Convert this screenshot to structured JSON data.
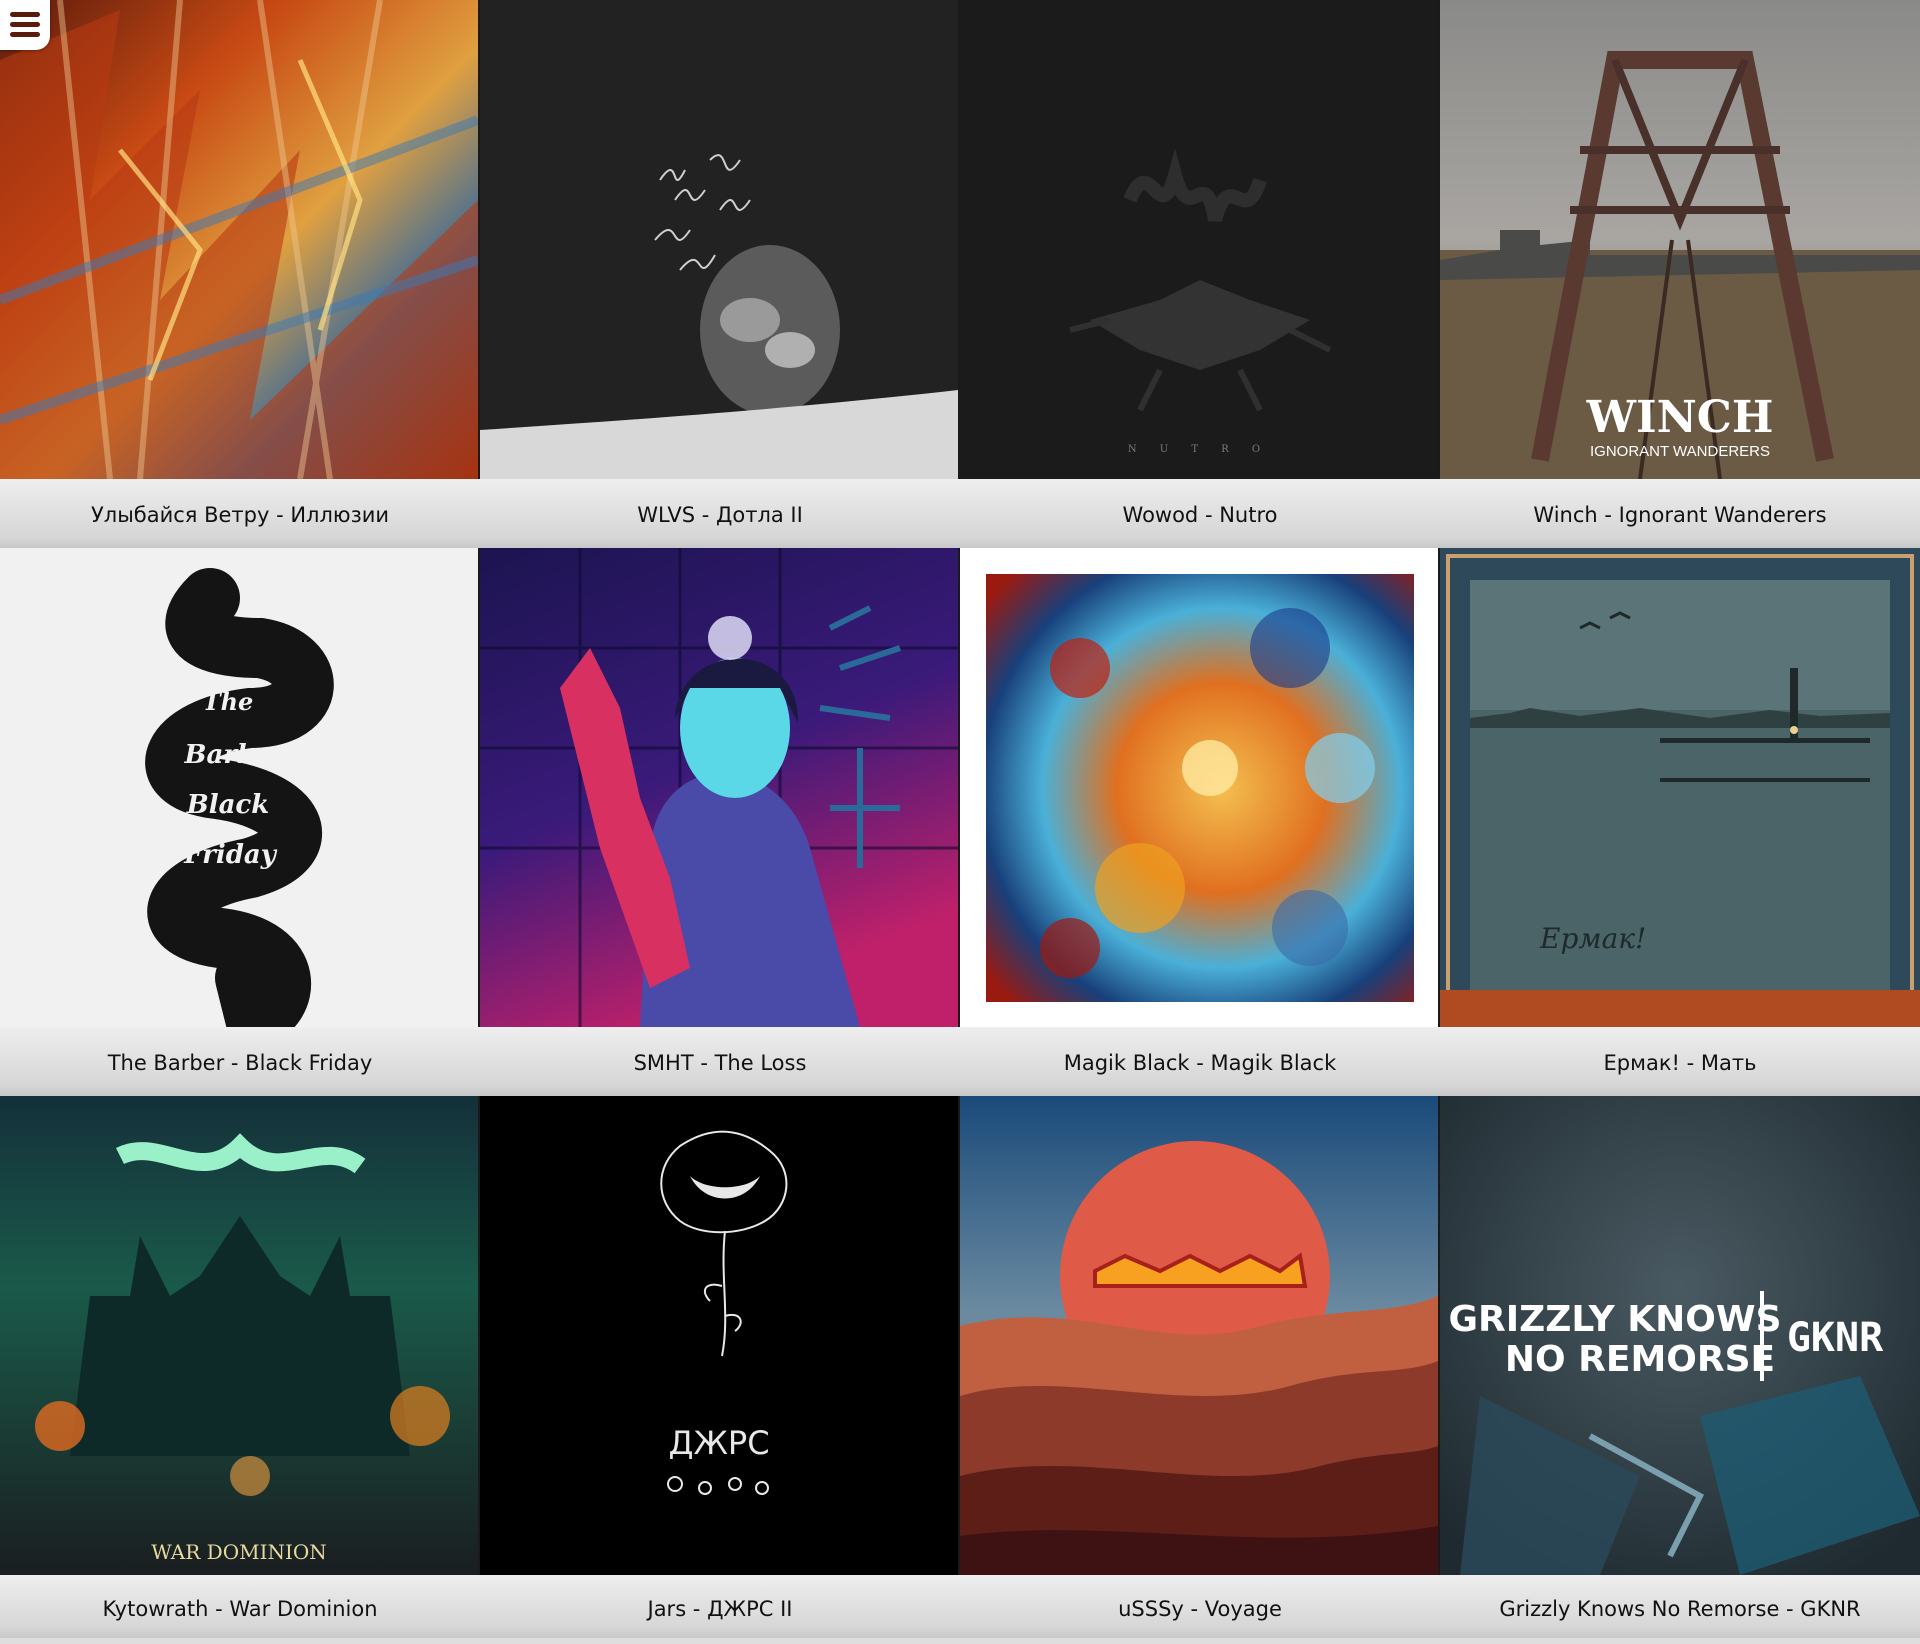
{
  "menu": {
    "icon": "hamburger-menu-icon"
  },
  "albums": [
    {
      "title": "Улыбайся Ветру - Иллюзии"
    },
    {
      "title": "WLVS - Дотла II"
    },
    {
      "title": "Wowod - Nutro",
      "cover_text": "N U T R O"
    },
    {
      "title": "Winch - Ignorant Wanderers",
      "cover_text": "WINCH",
      "cover_subtext": "IGNORANT WANDERERS"
    },
    {
      "title": "The Barber - Black Friday",
      "cover_lines": [
        "The",
        "Barber",
        "Black",
        "Friday"
      ]
    },
    {
      "title": "SMHT - The Loss"
    },
    {
      "title": "Magik Black - Magik Black"
    },
    {
      "title": "Ермак! - Мать",
      "cover_text": "Ермак!"
    },
    {
      "title": "Kytowrath - War Dominion",
      "cover_text": "WAR DOMINION"
    },
    {
      "title": "Jars - ДЖРС II",
      "cover_text": "ДЖРС"
    },
    {
      "title": "uSSSy - Voyage"
    },
    {
      "title": "Grizzly Knows No Remorse - GKNR",
      "cover_lines": [
        "GRIZZLY KNOWS",
        "NO REMORSE"
      ],
      "cover_logo": "GKNR"
    }
  ]
}
